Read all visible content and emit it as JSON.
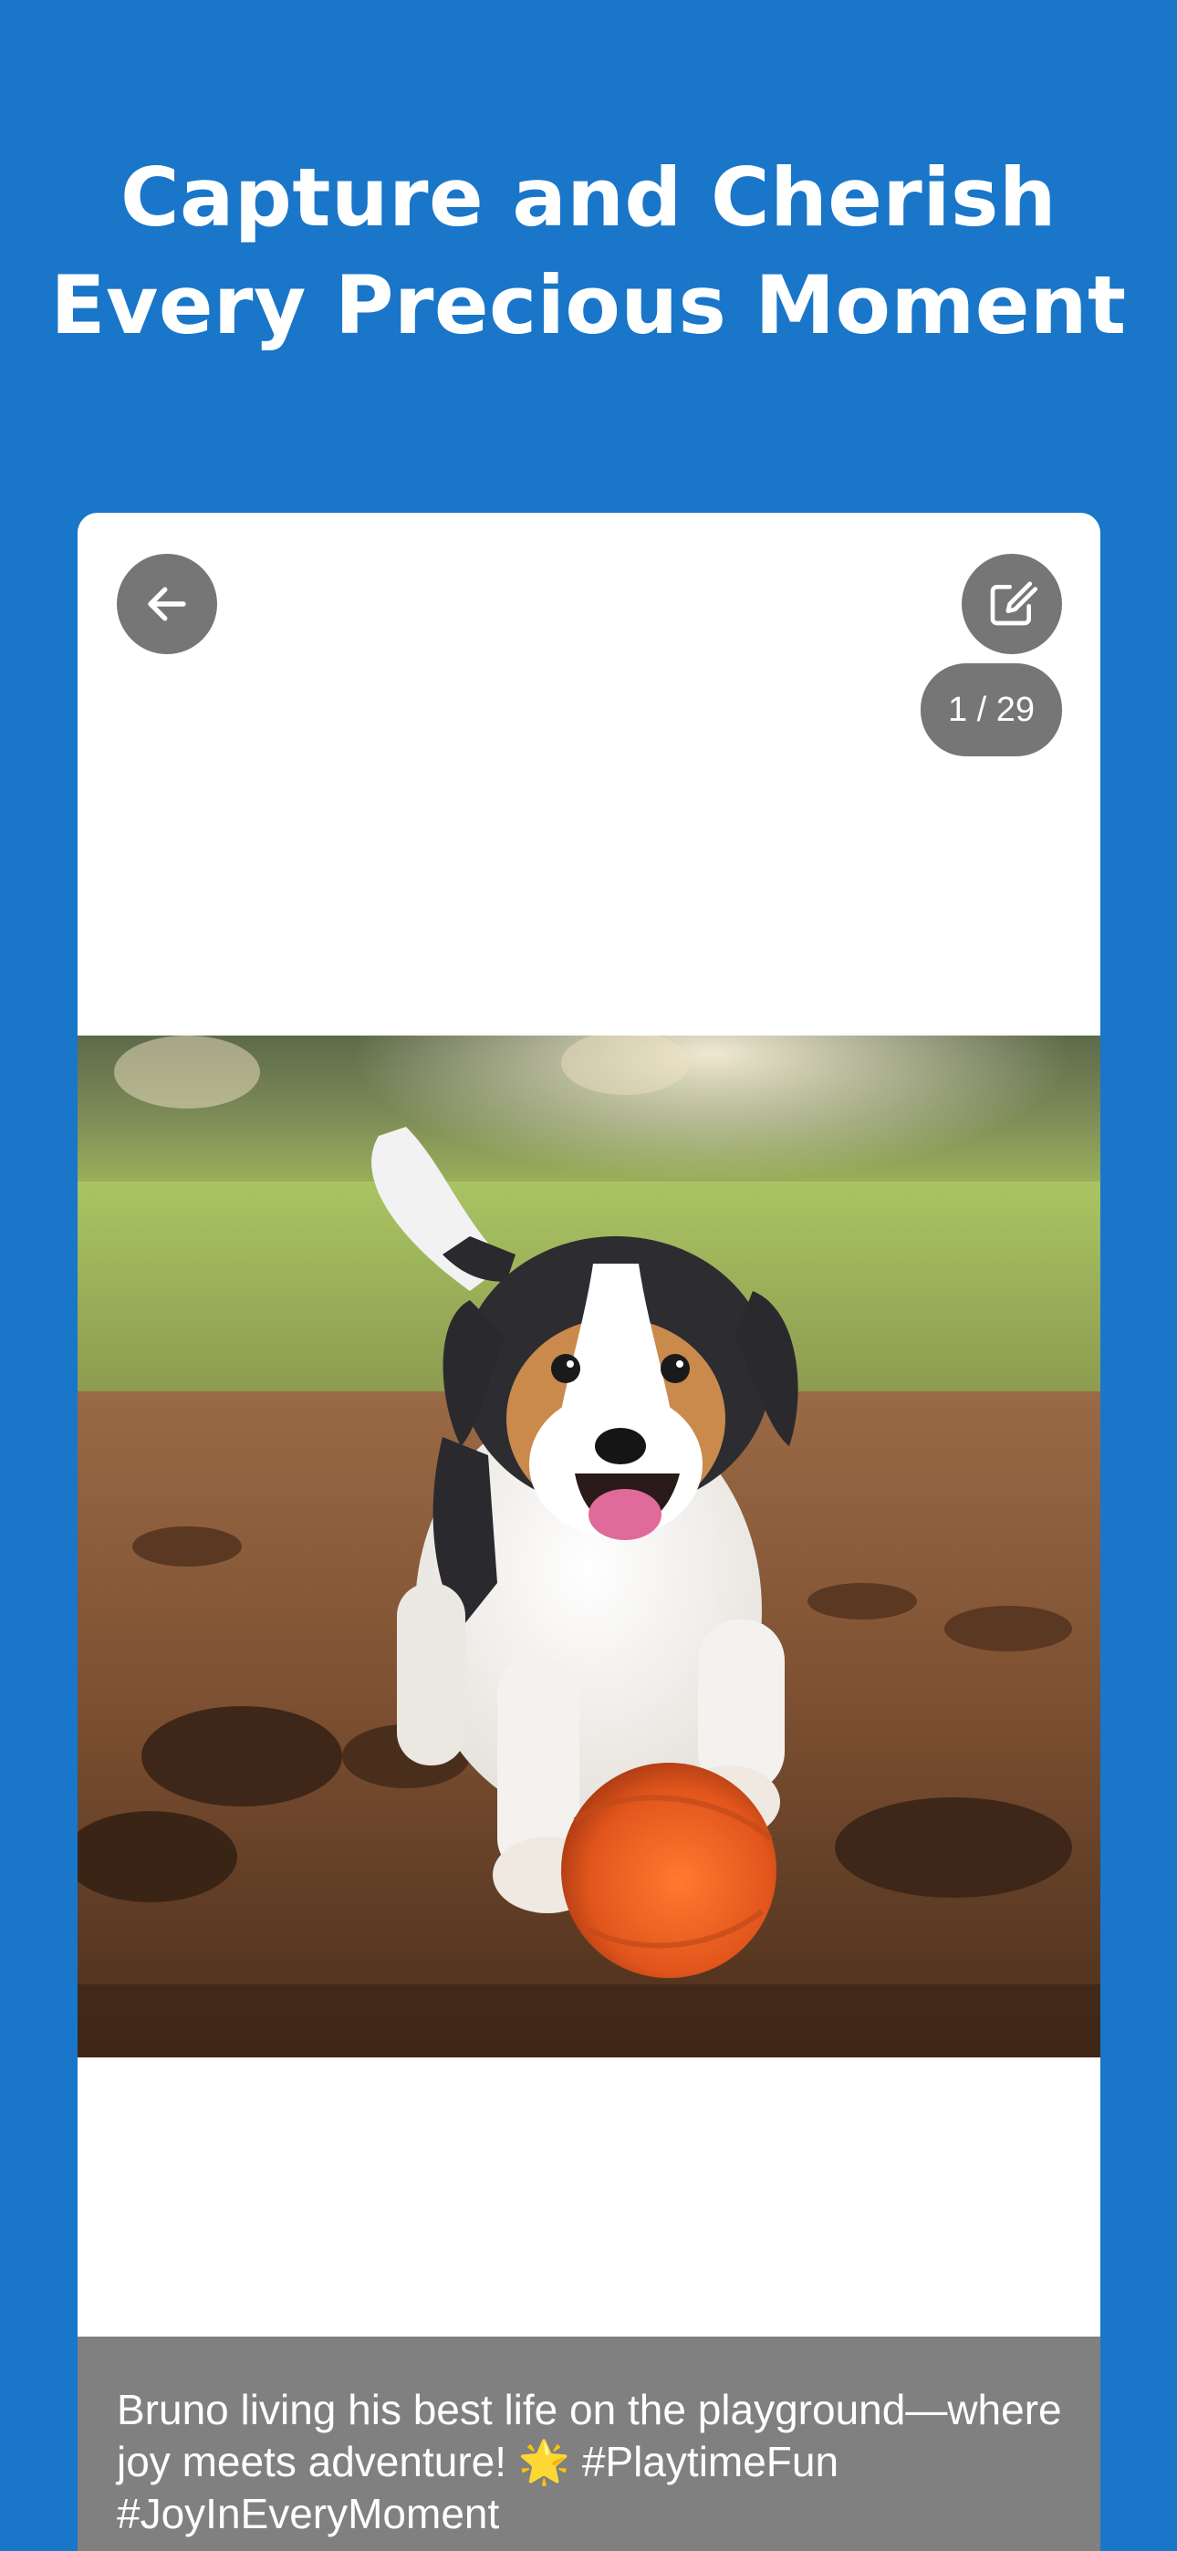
{
  "header": {
    "title_line1": "Capture and Cherish",
    "title_line2": "Every Precious Moment"
  },
  "viewer": {
    "back_icon": "arrow-left-icon",
    "edit_icon": "edit-icon",
    "counter": "1 / 29",
    "photo_subject": "puppy-with-ball-photo"
  },
  "caption": {
    "text": "Bruno living his best life on the playground—where joy meets adventure! 🌟 #PlaytimeFun #JoyInEveryMoment"
  },
  "colors": {
    "background": "#1976c9",
    "card": "#ffffff",
    "control": "#767676",
    "caption_bar": "#808080"
  }
}
